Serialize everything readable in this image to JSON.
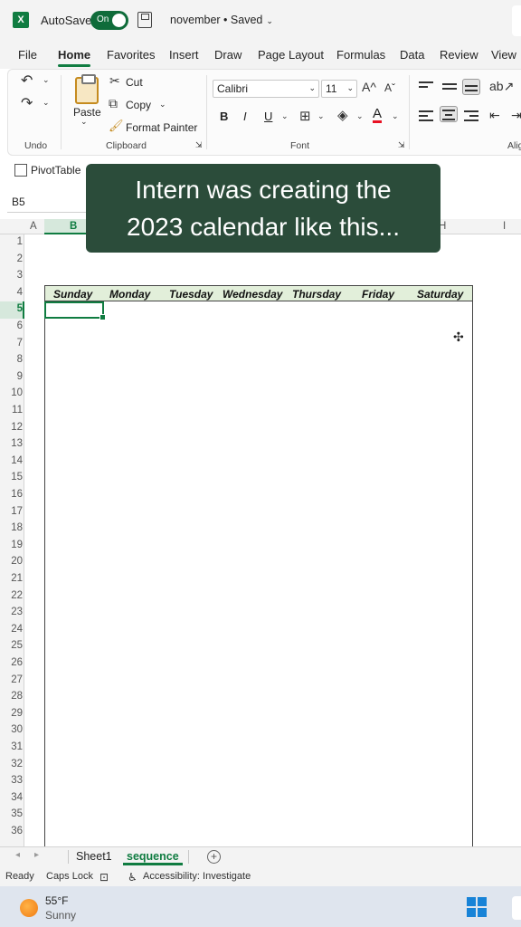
{
  "titlebar": {
    "app_logo": "X",
    "autosave_label": "AutoSave",
    "autosave_state": "On",
    "doc_title": "november • Saved"
  },
  "menu": [
    "File",
    "Home",
    "Favorites",
    "Insert",
    "Draw",
    "Page Layout",
    "Formulas",
    "Data",
    "Review",
    "View"
  ],
  "ribbon": {
    "undo_label": "Undo",
    "paste_label": "Paste",
    "cut_label": "Cut",
    "copy_label": "Copy",
    "format_painter_label": "Format Painter",
    "clipboard_label": "Clipboard",
    "font_name": "Calibri",
    "font_size": "11",
    "bold": "B",
    "italic": "I",
    "underline": "U",
    "font_label": "Font",
    "alignment_label": "Alig"
  },
  "quickbar": {
    "pivot_label": "PivotTable"
  },
  "namebox": {
    "value": "B5"
  },
  "grid": {
    "columns": [
      "A",
      "B",
      "H",
      "I"
    ],
    "rows": [
      "1",
      "2",
      "3",
      "4",
      "5",
      "6",
      "7",
      "8",
      "9",
      "10",
      "11",
      "12",
      "13",
      "14",
      "15",
      "16",
      "17",
      "18",
      "19",
      "20",
      "21",
      "22",
      "23",
      "24",
      "25",
      "26",
      "27",
      "28",
      "29",
      "30",
      "31",
      "32",
      "33",
      "34",
      "35",
      "36"
    ],
    "calendar_days": [
      "Sunday",
      "Monday",
      "Tuesday",
      "Wednesday",
      "Thursday",
      "Friday",
      "Saturday"
    ]
  },
  "caption": {
    "line1": "Intern was creating the",
    "line2": "2023 calendar like this..."
  },
  "sheets": {
    "sheet1": "Sheet1",
    "sheet2": "sequence",
    "add": "+"
  },
  "status": {
    "ready": "Ready",
    "caps": "Caps Lock",
    "accessibility": "Accessibility: Investigate"
  },
  "taskbar": {
    "temp": "55°F",
    "desc": "Sunny"
  },
  "colors": {
    "excel_green": "#107c41",
    "caption_bg": "#2b4c3a",
    "header_fill": "#e2efda"
  }
}
